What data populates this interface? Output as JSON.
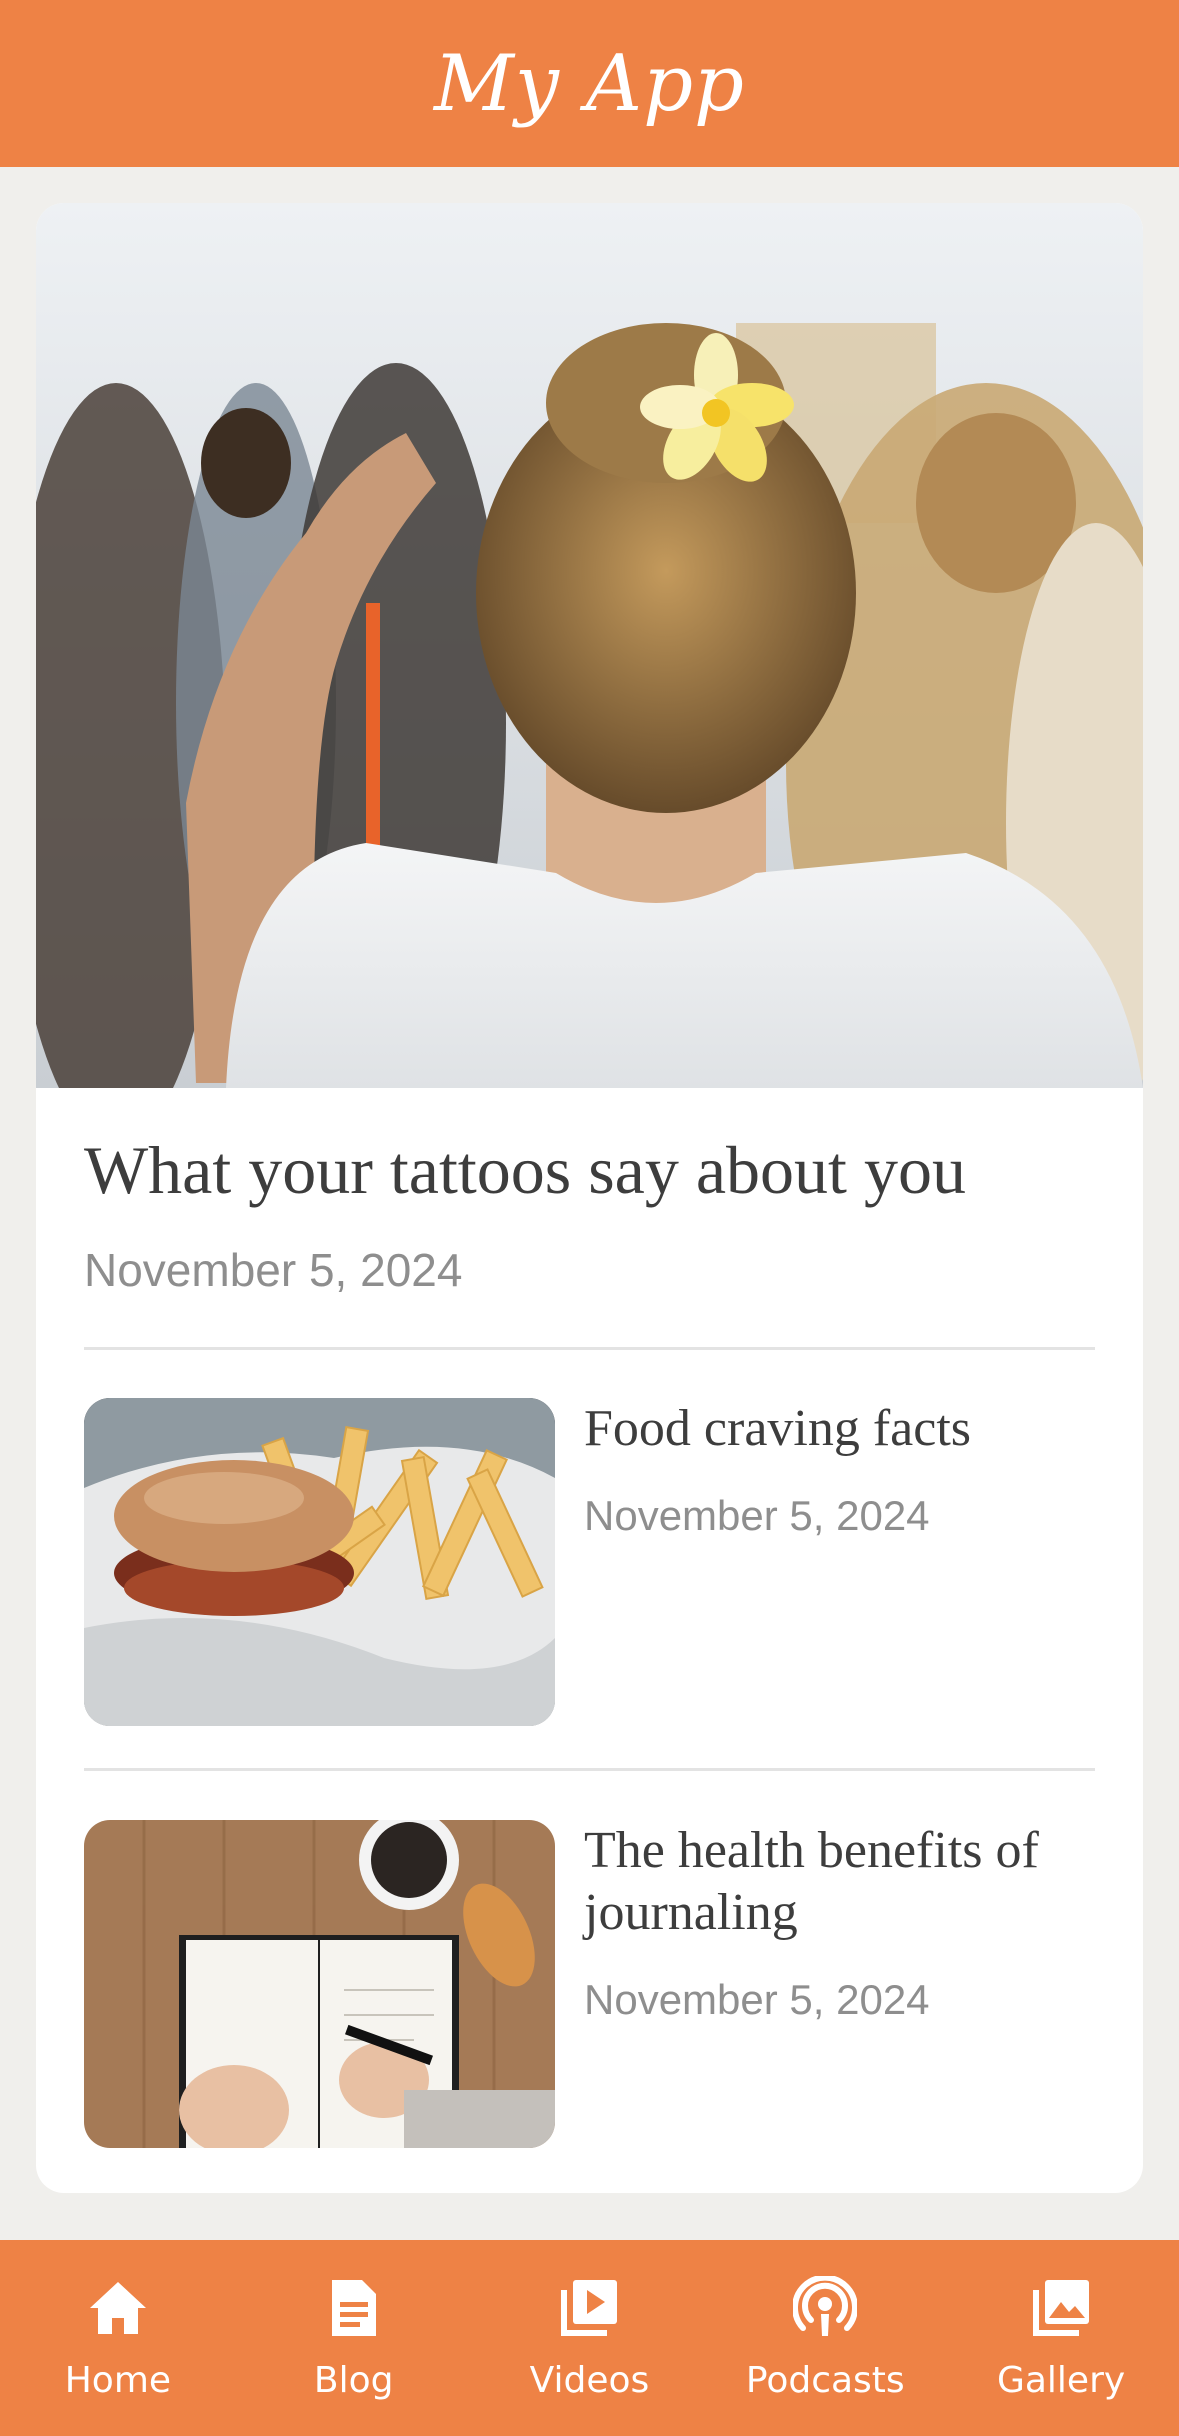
{
  "header": {
    "title": "My App",
    "background": "#ee8245"
  },
  "featured": {
    "title": "What your tattoos say about you",
    "date": "November 5, 2024"
  },
  "articles": [
    {
      "title": "Food craving facts",
      "date": "November 5, 2024"
    },
    {
      "title": "The health benefits of journaling",
      "date": "November 5, 2024"
    }
  ],
  "nav": {
    "items": [
      {
        "label": "Home",
        "icon": "home-icon"
      },
      {
        "label": "Blog",
        "icon": "document-icon"
      },
      {
        "label": "Videos",
        "icon": "video-library-icon"
      },
      {
        "label": "Podcasts",
        "icon": "podcast-icon"
      },
      {
        "label": "Gallery",
        "icon": "gallery-icon"
      }
    ]
  },
  "colors": {
    "accent": "#ee8245",
    "background": "#f0efec",
    "card": "#ffffff"
  }
}
